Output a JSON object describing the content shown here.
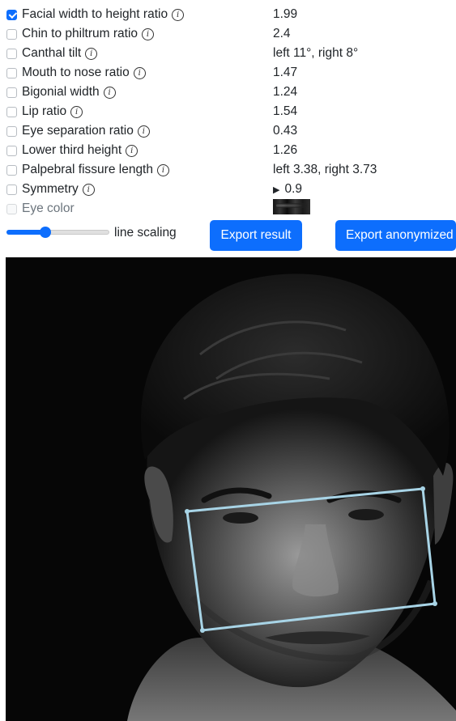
{
  "metrics": [
    {
      "id": "fwhr",
      "label": "Facial width to height ratio",
      "value": "1.99",
      "checked": true,
      "disabled": false,
      "has_info": true,
      "icon": "info-icon"
    },
    {
      "id": "chin",
      "label": "Chin to philtrum ratio",
      "value": "2.4",
      "checked": false,
      "disabled": false,
      "has_info": true,
      "icon": "info-icon"
    },
    {
      "id": "canthal",
      "label": "Canthal tilt",
      "value": "left 11°, right 8°",
      "checked": false,
      "disabled": false,
      "has_info": true,
      "icon": "info-icon"
    },
    {
      "id": "mouth",
      "label": "Mouth to nose ratio",
      "value": "1.47",
      "checked": false,
      "disabled": false,
      "has_info": true,
      "icon": "info-icon"
    },
    {
      "id": "bigonial",
      "label": "Bigonial width",
      "value": "1.24",
      "checked": false,
      "disabled": false,
      "has_info": true,
      "icon": "info-icon"
    },
    {
      "id": "lip",
      "label": "Lip ratio",
      "value": "1.54",
      "checked": false,
      "disabled": false,
      "has_info": true,
      "icon": "info-icon"
    },
    {
      "id": "eyesep",
      "label": "Eye separation ratio",
      "value": "0.43",
      "checked": false,
      "disabled": false,
      "has_info": true,
      "icon": "info-icon"
    },
    {
      "id": "lowerthird",
      "label": "Lower third height",
      "value": "1.26",
      "checked": false,
      "disabled": false,
      "has_info": true,
      "icon": "info-icon"
    },
    {
      "id": "palpebral",
      "label": "Palpebral fissure length",
      "value": "left 3.38, right 3.73",
      "checked": false,
      "disabled": false,
      "has_info": true,
      "icon": "info-icon"
    },
    {
      "id": "symmetry",
      "label": "Symmetry",
      "value": "0.9",
      "value_prefix": "▶",
      "checked": false,
      "disabled": false,
      "has_info": true,
      "icon": "info-icon"
    },
    {
      "id": "eyecolor",
      "label": "Eye color",
      "value": "",
      "checked": false,
      "disabled": true,
      "has_info": false,
      "value_icon": "eye-color-swatch"
    }
  ],
  "controls": {
    "line_scaling_label": "line scaling",
    "line_scaling_level": 0.38,
    "export_result_label": "Export result",
    "export_anonymized_label": "Export anonymized"
  },
  "colors": {
    "accent": "#0d6efd",
    "overlay_line": "#a8d4e6"
  },
  "photo": {
    "subject": "black-and-white portrait",
    "overlay": "facial-width-to-height-box"
  }
}
